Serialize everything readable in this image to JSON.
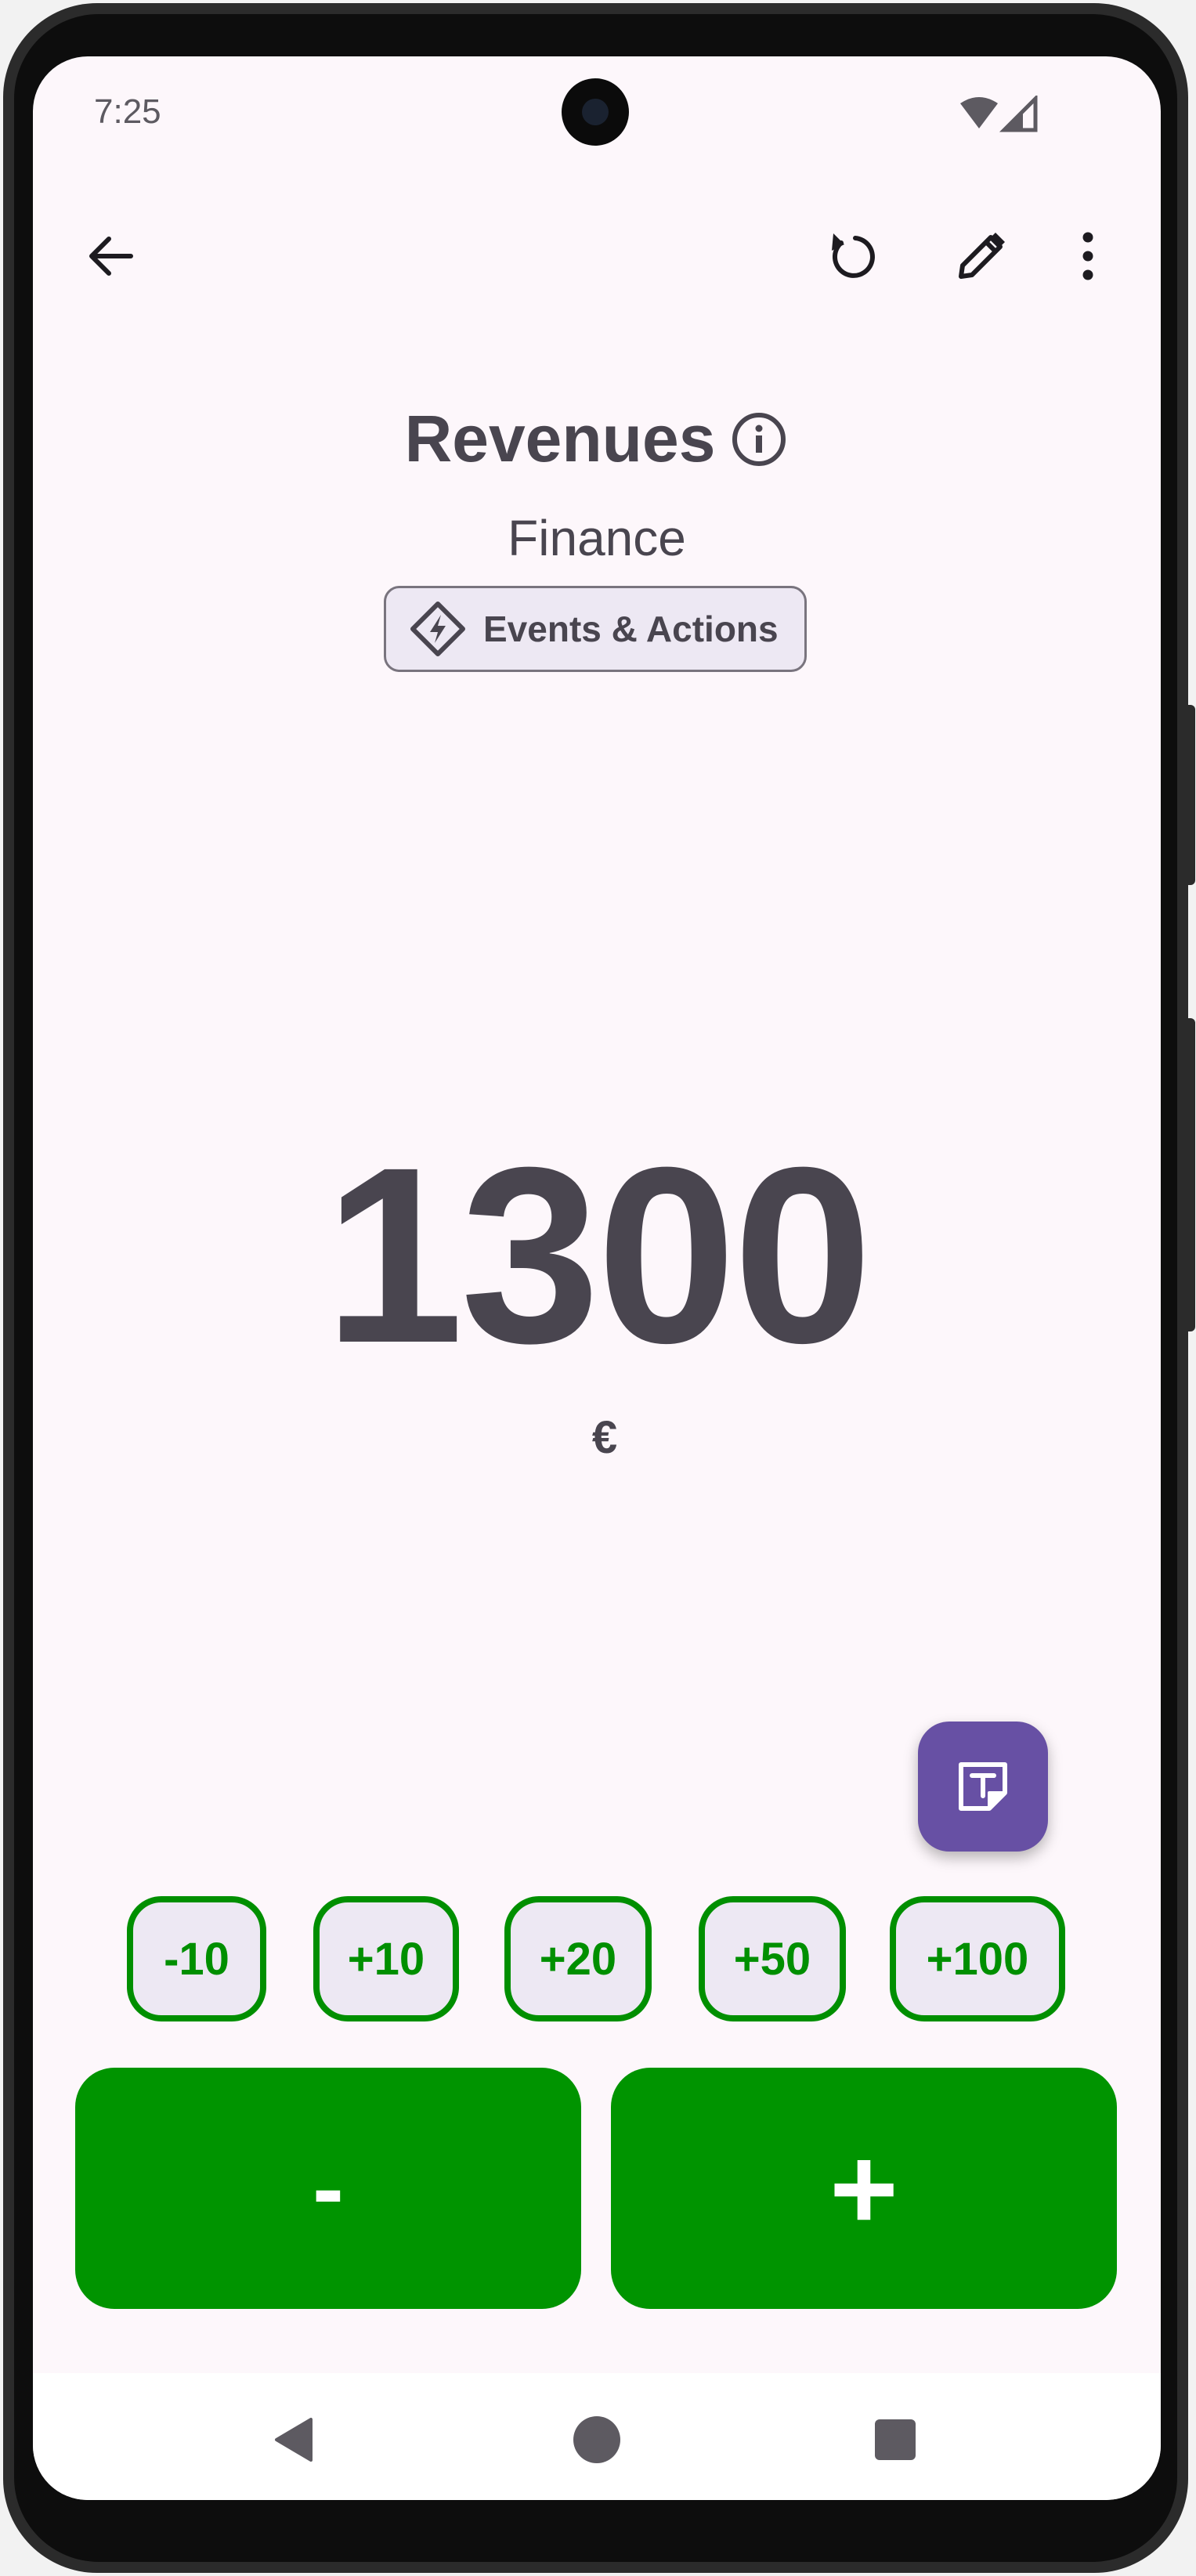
{
  "status_bar": {
    "time": "7:25"
  },
  "app_bar": {
    "back_icon": "arrow-back-icon",
    "reset_icon": "reset-icon",
    "edit_icon": "pencil-icon",
    "menu_icon": "more-vert-icon"
  },
  "counter": {
    "title": "Revenues",
    "category": "Finance",
    "events_label": "Events & Actions",
    "value": "1300",
    "unit": "€"
  },
  "steps": [
    "-10",
    "+10",
    "+20",
    "+50",
    "+100"
  ],
  "controls": {
    "decrement_label": "-",
    "increment_label": "+"
  },
  "colors": {
    "accent_green": "#009400",
    "fab_purple": "#6750a4",
    "text": "#49454f",
    "background": "#fdf7fb"
  }
}
